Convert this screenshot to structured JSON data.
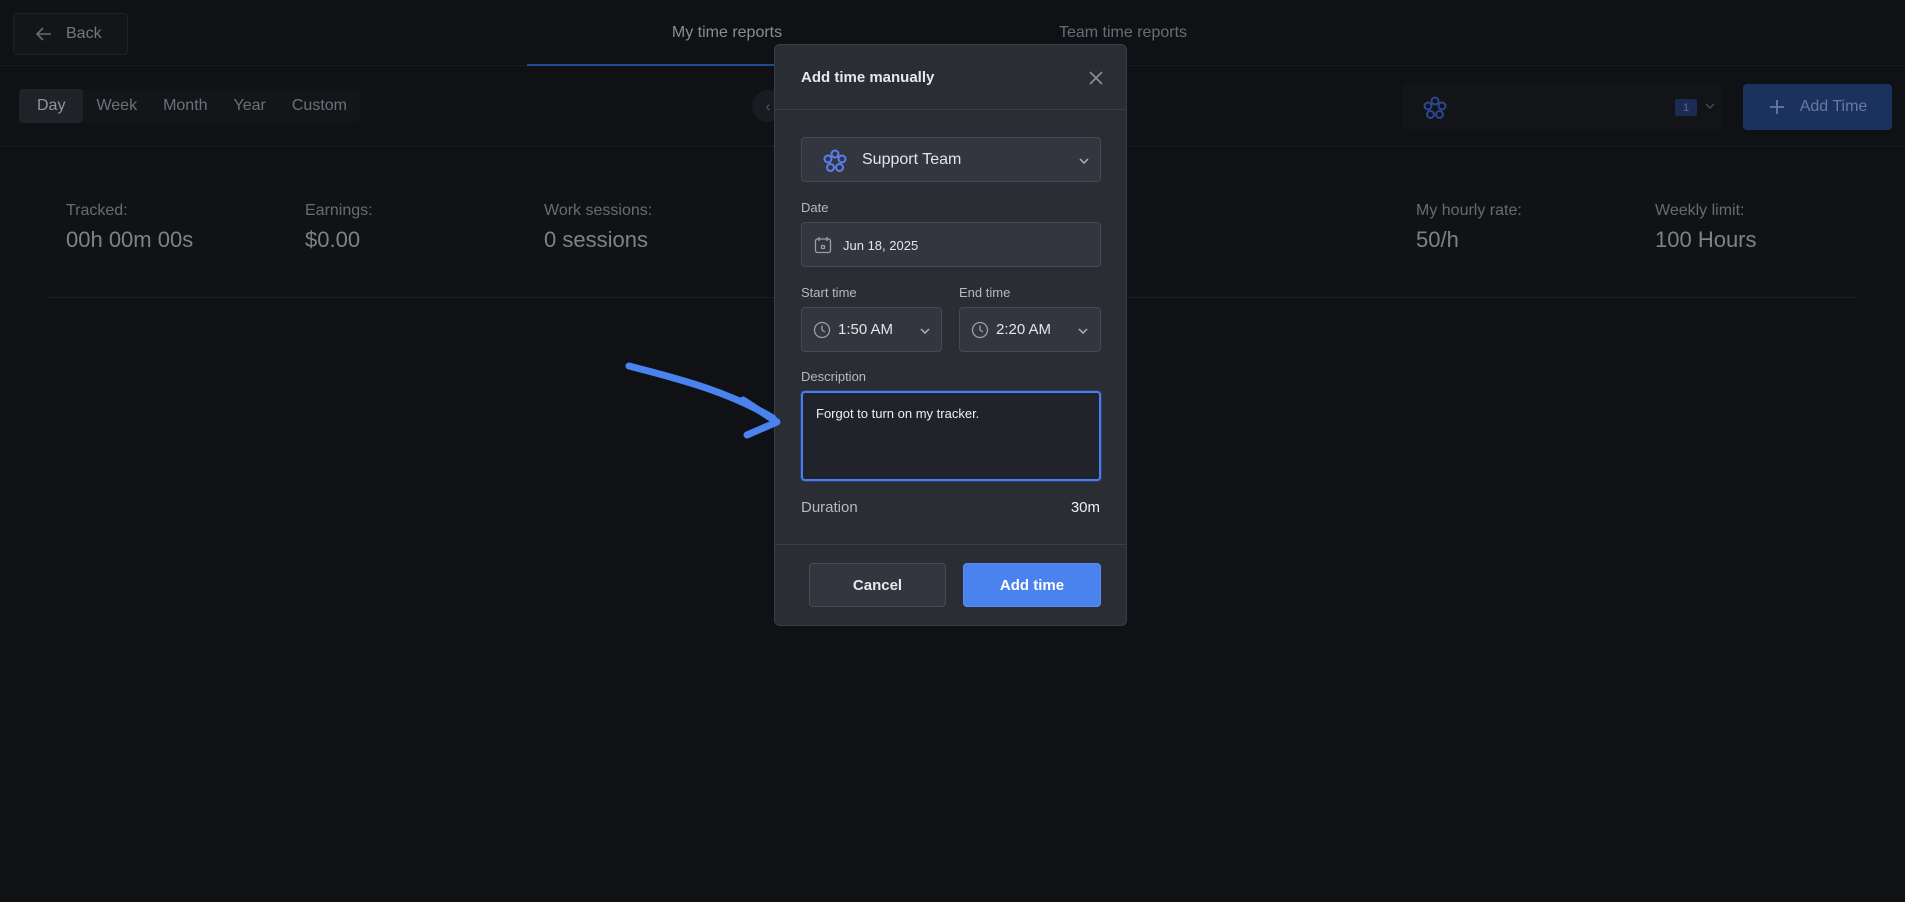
{
  "header": {
    "back_label": "Back",
    "tabs": [
      {
        "label": "My time reports",
        "active": true
      },
      {
        "label": "Team time reports",
        "active": false
      }
    ]
  },
  "toolbar": {
    "ranges": [
      "Day",
      "Week",
      "Month",
      "Year",
      "Custom"
    ],
    "active_range": "Day",
    "prev_icon": "chevron-left-icon",
    "team_count_badge": "1",
    "add_time_label": "Add Time"
  },
  "stats": [
    {
      "label": "Tracked:",
      "value": "00h 00m 00s"
    },
    {
      "label": "Earnings:",
      "value": "$0.00"
    },
    {
      "label": "Work sessions:",
      "value": "0 sessions"
    },
    {
      "label": "My hourly rate:",
      "value": "50/h"
    },
    {
      "label": "Weekly limit:",
      "value": "100 Hours"
    }
  ],
  "modal": {
    "title": "Add time manually",
    "team": "Support Team",
    "date_label": "Date",
    "date_value": "Jun 18, 2025",
    "start_label": "Start time",
    "start_value": "1:50 AM",
    "end_label": "End time",
    "end_value": "2:20 AM",
    "description_label": "Description",
    "description_value": "Forgot to turn on my tracker.",
    "duration_label": "Duration",
    "duration_value": "30m",
    "cancel_label": "Cancel",
    "submit_label": "Add time"
  },
  "colors": {
    "accent": "#4a82ee",
    "annotation_arrow": "#4a82ee",
    "background": "#15171c",
    "modal_bg": "#2a2d34"
  }
}
